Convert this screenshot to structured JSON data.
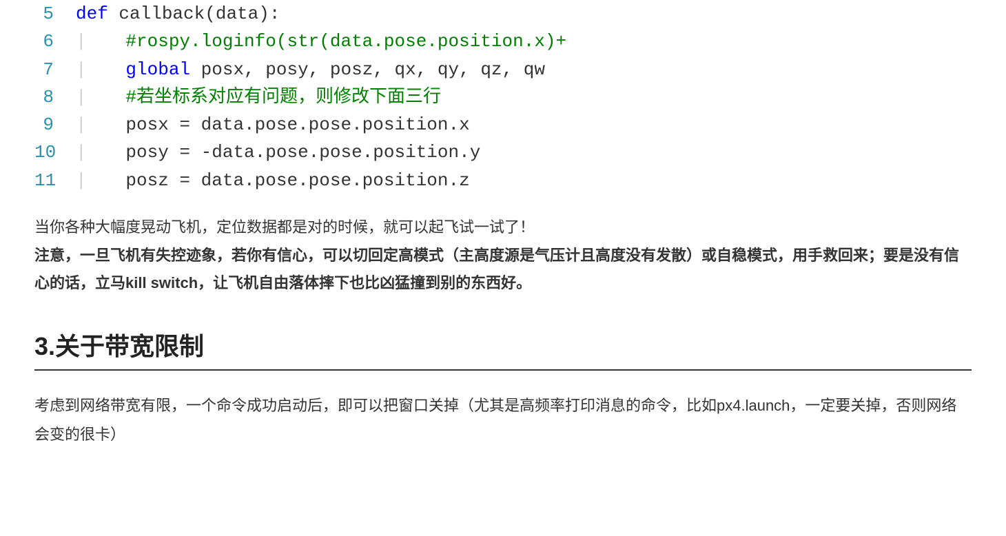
{
  "code": {
    "lines": [
      {
        "n": "5",
        "segments": [
          {
            "cls": "k-def",
            "t": "def"
          },
          {
            "cls": "plain",
            "t": " "
          },
          {
            "cls": "fn",
            "t": "callback(data):"
          }
        ]
      },
      {
        "n": "6",
        "guide": true,
        "segments": [
          {
            "cls": "comment",
            "t": "#rospy.loginfo(str(data.pose.position.x)+"
          }
        ]
      },
      {
        "n": "7",
        "guide": true,
        "segments": [
          {
            "cls": "k-global",
            "t": "global"
          },
          {
            "cls": "plain",
            "t": " posx, posy, posz, qx, qy, qz, qw"
          }
        ]
      },
      {
        "n": "8",
        "guide": true,
        "segments": [
          {
            "cls": "comment",
            "t": "#若坐标系对应有问题，则修改下面三行"
          }
        ]
      },
      {
        "n": "9",
        "guide": true,
        "segments": [
          {
            "cls": "plain",
            "t": "posx = data.pose.pose.position.x"
          }
        ]
      },
      {
        "n": "10",
        "guide": true,
        "segments": [
          {
            "cls": "plain",
            "t": "posy = -data.pose.pose.position.y"
          }
        ]
      },
      {
        "n": "11",
        "guide": true,
        "segments": [
          {
            "cls": "plain",
            "t": "posz = data.pose.pose.position.z"
          }
        ]
      }
    ]
  },
  "prose": {
    "p1": "当你各种大幅度晃动飞机，定位数据都是对的时候，就可以起飞试一试了！",
    "p2_bold": "注意，一旦飞机有失控迹象，若你有信心，可以切回定高模式（主高度源是气压计且高度没有发散）或自稳模式，用手救回来；要是没有信心的话，立马kill switch，让飞机自由落体摔下也比凶猛撞到别的东西好。"
  },
  "heading": "3.关于带宽限制",
  "prose2": {
    "p1": "考虑到网络带宽有限，一个命令成功启动后，即可以把窗口关掉（尤其是高频率打印消息的命令，比如px4.launch，一定要关掉，否则网络会变的很卡）"
  }
}
